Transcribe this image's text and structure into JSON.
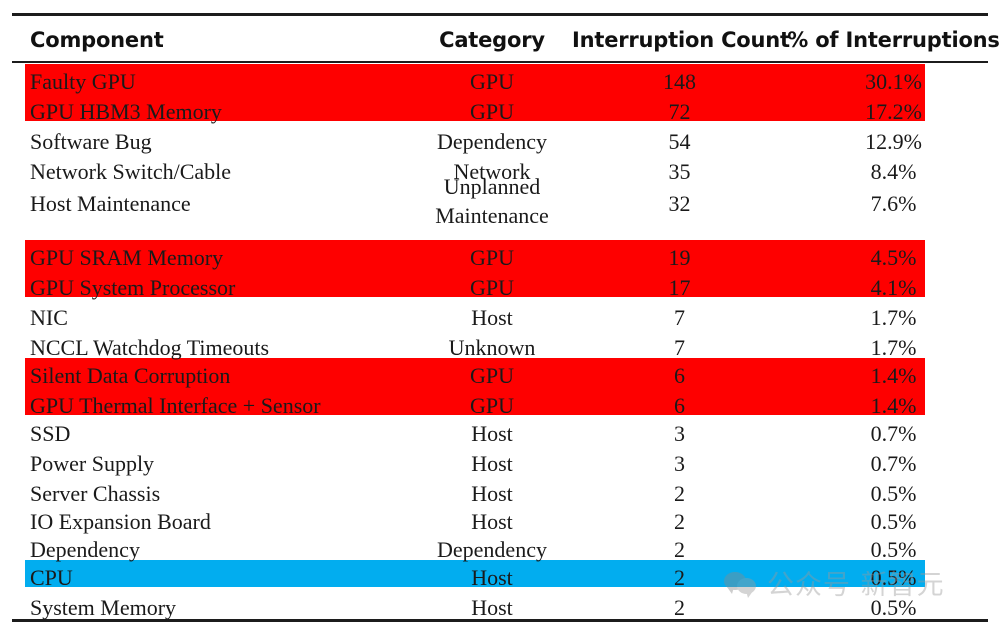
{
  "table": {
    "columns": [
      {
        "key": "component",
        "label": "Component",
        "align": "left"
      },
      {
        "key": "category",
        "label": "Category",
        "align": "center"
      },
      {
        "key": "count",
        "label": "Interruption Count",
        "align": "center"
      },
      {
        "key": "percent",
        "label": "% of Interruptions",
        "align": "center"
      }
    ],
    "rows": [
      {
        "component": "Faulty GPU",
        "category": "GPU",
        "count": "148",
        "percent": "30.1%",
        "highlight": "red"
      },
      {
        "component": "GPU HBM3 Memory",
        "category": "GPU",
        "count": "72",
        "percent": "17.2%",
        "highlight": "red"
      },
      {
        "component": "Software Bug",
        "category": "Dependency",
        "count": "54",
        "percent": "12.9%",
        "highlight": "none"
      },
      {
        "component": "Network Switch/Cable",
        "category": "Network",
        "count": "35",
        "percent": "8.4%",
        "highlight": "none"
      },
      {
        "component": "Host Maintenance",
        "category": "Unplanned Maintenance",
        "count": "32",
        "percent": "7.6%",
        "highlight": "none"
      },
      {
        "component": "GPU SRAM Memory",
        "category": "GPU",
        "count": "19",
        "percent": "4.5%",
        "highlight": "red"
      },
      {
        "component": "GPU System Processor",
        "category": "GPU",
        "count": "17",
        "percent": "4.1%",
        "highlight": "red"
      },
      {
        "component": "NIC",
        "category": "Host",
        "count": "7",
        "percent": "1.7%",
        "highlight": "none"
      },
      {
        "component": "NCCL Watchdog Timeouts",
        "category": "Unknown",
        "count": "7",
        "percent": "1.7%",
        "highlight": "none"
      },
      {
        "component": "Silent Data Corruption",
        "category": "GPU",
        "count": "6",
        "percent": "1.4%",
        "highlight": "red"
      },
      {
        "component": "GPU Thermal Interface + Sensor",
        "category": "GPU",
        "count": "6",
        "percent": "1.4%",
        "highlight": "red"
      },
      {
        "component": "SSD",
        "category": "Host",
        "count": "3",
        "percent": "0.7%",
        "highlight": "none"
      },
      {
        "component": "Power Supply",
        "category": "Host",
        "count": "3",
        "percent": "0.7%",
        "highlight": "none"
      },
      {
        "component": "Server Chassis",
        "category": "Host",
        "count": "2",
        "percent": "0.5%",
        "highlight": "none"
      },
      {
        "component": "IO Expansion Board",
        "category": "Host",
        "count": "2",
        "percent": "0.5%",
        "highlight": "none"
      },
      {
        "component": "Dependency",
        "category": "Dependency",
        "count": "2",
        "percent": "0.5%",
        "highlight": "none"
      },
      {
        "component": "CPU",
        "category": "Host",
        "count": "2",
        "percent": "0.5%",
        "highlight": "blue"
      },
      {
        "component": "System Memory",
        "category": "Host",
        "count": "2",
        "percent": "0.5%",
        "highlight": "none"
      }
    ]
  },
  "colors": {
    "highlight_red": "#fe0000",
    "highlight_blue": "#02adef",
    "rule": "#1c1c1c",
    "text": "#1a1a1a",
    "background": "#ffffff"
  },
  "watermark": {
    "text": "公众号 新智元",
    "logo_icon": "wechat-logo-icon"
  }
}
